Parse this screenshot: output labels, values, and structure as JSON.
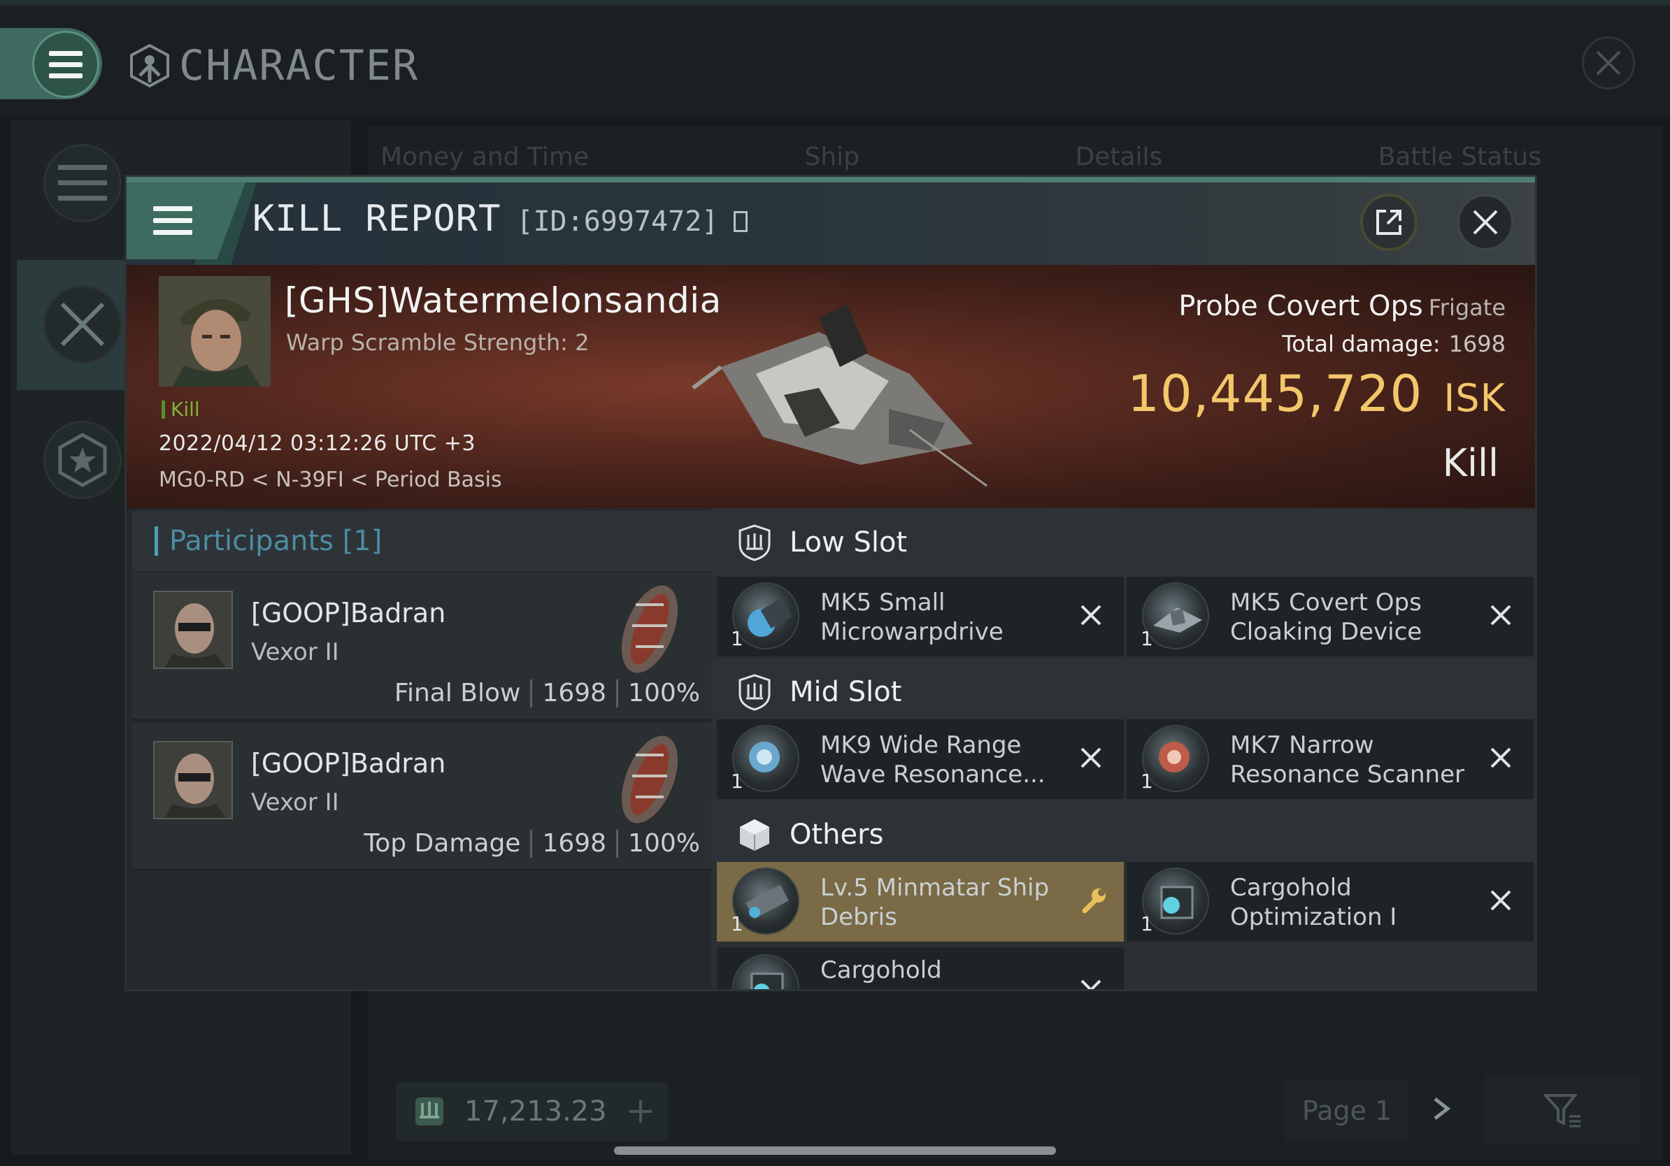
{
  "window": {
    "title": "CHARACTER",
    "tabs": [
      "Money and Time",
      "Ship",
      "Details",
      "Battle Status"
    ],
    "wallet_value": "17,213.23",
    "page_label": "Page 1"
  },
  "kill_report": {
    "title": "KILL REPORT",
    "id": "[ID:6997472]",
    "victim": {
      "name": "[GHS]Watermelonsandia",
      "subtitle": "Warp Scramble Strength: 2",
      "tag": "Kill",
      "timestamp": "2022/04/12 03:12:26 UTC +3",
      "location": "MG0-RD < N-39FI < Period Basis"
    },
    "ship_name": "Probe Covert Ops",
    "ship_class": "Frigate",
    "total_damage_label": "Total damage:",
    "total_damage": "1698",
    "isk_value": "10,445,720",
    "isk_unit": "ISK",
    "result": "Kill",
    "participants_label": "Participants [1]",
    "participants": [
      {
        "name": "[GOOP]Badran",
        "ship": "Vexor II",
        "role": "Final Blow",
        "damage": "1698",
        "percent": "100%"
      },
      {
        "name": "[GOOP]Badran",
        "ship": "Vexor II",
        "role": "Top Damage",
        "damage": "1698",
        "percent": "100%"
      }
    ],
    "slots": {
      "low": {
        "label": "Low Slot",
        "items": [
          {
            "qty": "1",
            "line1": "MK5 Small",
            "line2": "Microwarpdrive"
          },
          {
            "qty": "1",
            "line1": "MK5 Covert Ops",
            "line2": "Cloaking Device"
          }
        ]
      },
      "mid": {
        "label": "Mid Slot",
        "items": [
          {
            "qty": "1",
            "line1": "MK9 Wide Range",
            "line2": "Wave Resonance..."
          },
          {
            "qty": "1",
            "line1": "MK7 Narrow",
            "line2": "Resonance Scanner"
          }
        ]
      },
      "others": {
        "label": "Others",
        "items": [
          {
            "qty": "1",
            "line1": "Lv.5 Minmatar Ship",
            "line2": "Debris"
          },
          {
            "qty": "1",
            "line1": "Cargohold",
            "line2": "Optimization I"
          },
          {
            "qty": "",
            "line1": "Cargohold",
            "line2": ""
          }
        ]
      }
    }
  },
  "colors": {
    "accent_green": "#3f6a5f",
    "isk_gold": "#f3c66a",
    "kill_green": "#7fb33b",
    "participants_blue": "#4d8ca2",
    "selected_item": "#7a6a45"
  }
}
